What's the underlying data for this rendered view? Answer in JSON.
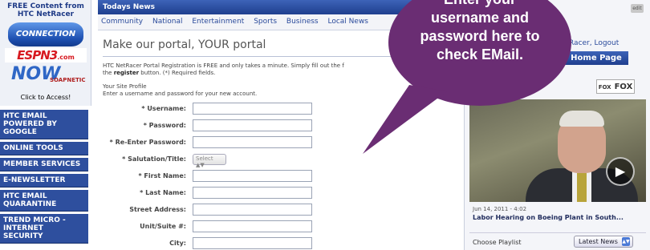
{
  "left": {
    "free_content": "FREE Content from HTC NetRacer",
    "logo_connection": "CONNECTION",
    "logo_espn": "ESPN3",
    "logo_espn_sub": ".com",
    "logo_now": "NOW",
    "logo_soap": "SOAPNETIC",
    "click_access": "Click to Access!",
    "menu": [
      {
        "label": "HTC EMAIL POWERED BY GOOGLE"
      },
      {
        "label": "ONLINE TOOLS"
      },
      {
        "label": "MEMBER SERVICES"
      },
      {
        "label": "E-NEWSLETTER"
      },
      {
        "label": "HTC EMAIL QUARANTINE"
      },
      {
        "label": "TREND MICRO - INTERNET SECURITY"
      }
    ]
  },
  "main": {
    "news_title": "Todays News",
    "nav": [
      "Community",
      "National",
      "Entertainment",
      "Sports",
      "Business",
      "Local News"
    ],
    "portal_title": "Make our portal, YOUR portal",
    "info_line1": "HTC NetRacer Portal Registration is FREE and only takes a minute. Simply fill out the f",
    "info_line2_pre": "the ",
    "info_line2_bold": "register",
    "info_line2_post": " button. (*) Required fields.",
    "profile_title": "Your Site Profile",
    "profile_desc": "Enter a username and password for your new account.",
    "fields": {
      "username": "* Username:",
      "password": "* Password:",
      "reenter": "* Re-Enter Password:",
      "salutation": "* Salutation/Title:",
      "salutation_value": "Select",
      "first_name": "* First Name:",
      "last_name": "* Last Name:",
      "street": "Street Address:",
      "unit": "Unit/Suite #:",
      "city": "City:"
    }
  },
  "right": {
    "edit": "edit",
    "login_text": "Racer, Logout",
    "home_page": "Home Page",
    "fox_small": "FOX",
    "fox_logo": "FOX",
    "video_date": "Jun 14, 2011 - 4:02",
    "video_title": "Labor Hearing on Boeing Plant in South...",
    "playlist_label": "Choose Playlist",
    "playlist_value": "Latest News",
    "play_symbol": "▶",
    "select_arrow": "▲▼"
  },
  "callout": {
    "line1": "Enter your",
    "line2": "username and",
    "line3": "password here to",
    "line4": "check EMail."
  },
  "colors": {
    "bubble": "#6a2d73",
    "nav_blue": "#2e4f9e",
    "header_blue": "#1f3f8e"
  }
}
